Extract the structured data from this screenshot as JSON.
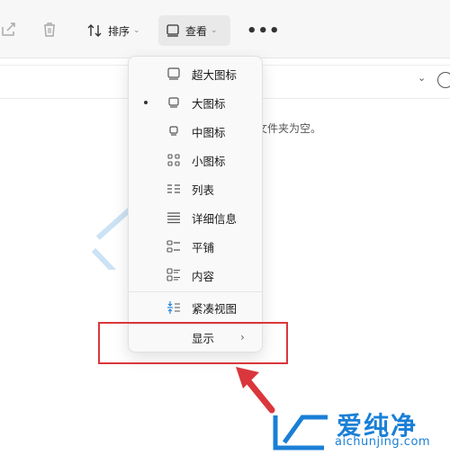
{
  "toolbar": {
    "sort_label": "排序",
    "view_label": "查看",
    "more_label": "•••"
  },
  "content": {
    "empty_message": "文件夹为空。"
  },
  "view_menu": {
    "items": [
      {
        "label": "超大图标",
        "icon": "monitor-icon",
        "selected": false
      },
      {
        "label": "大图标",
        "icon": "monitor-icon",
        "selected": true
      },
      {
        "label": "中图标",
        "icon": "monitor-small-icon",
        "selected": false
      },
      {
        "label": "小图标",
        "icon": "grid-icon",
        "selected": false
      },
      {
        "label": "列表",
        "icon": "list-icon",
        "selected": false
      },
      {
        "label": "详细信息",
        "icon": "details-icon",
        "selected": false
      },
      {
        "label": "平铺",
        "icon": "tiles-icon",
        "selected": false
      },
      {
        "label": "内容",
        "icon": "content-icon",
        "selected": false
      },
      {
        "label": "紧凑视图",
        "icon": "compact-icon",
        "selected": false
      },
      {
        "label": "显示",
        "icon": "",
        "selected": false
      }
    ]
  },
  "watermark": {
    "brand": "爱纯净",
    "url": "aichunjing.com"
  },
  "colors": {
    "accent": "#1a7fd6",
    "highlight": "#d9373c"
  }
}
